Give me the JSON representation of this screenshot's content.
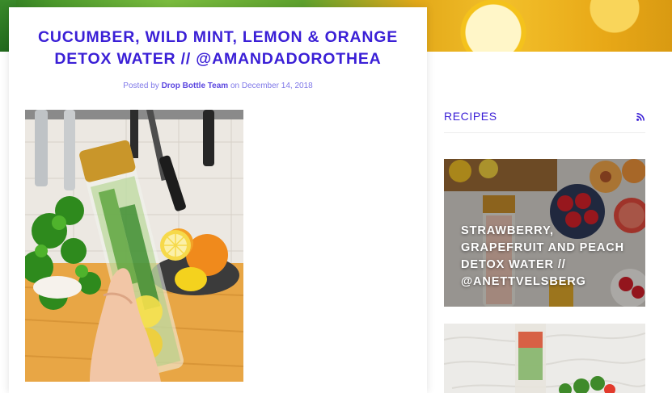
{
  "post": {
    "title": "CUCUMBER, WILD MINT, LEMON & ORANGE DETOX WATER // @AMANDADOROTHEA",
    "byline_prefix": "Posted by",
    "author": "Drop Bottle Team",
    "byline_on": "on",
    "date": "December 14, 2018",
    "image_icon": "infused-water-bottle-photo"
  },
  "sidebar": {
    "widget_title": "RECIPES",
    "feed_icon": "rss-icon",
    "recipes": [
      {
        "title": "STRAWBERRY, GRAPEFRUIT AND PEACH DETOX WATER // @ANETTVELSBERG"
      },
      {
        "title": ""
      }
    ]
  },
  "colors": {
    "accent": "#3a1fd6",
    "byline": "#7f78e8"
  }
}
